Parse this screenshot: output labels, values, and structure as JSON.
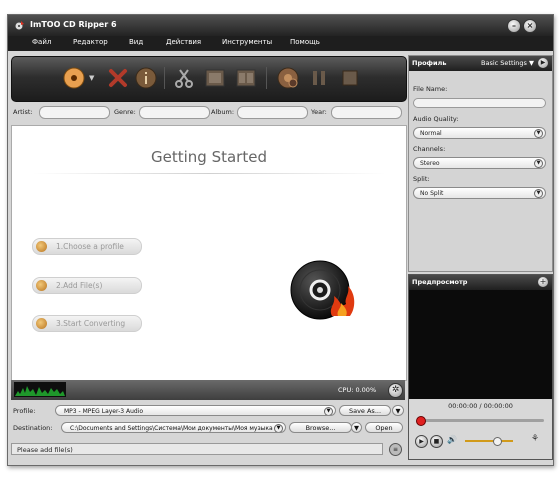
{
  "window": {
    "title": "ImTOO CD Ripper 6"
  },
  "menu": [
    "Файл",
    "Редактор",
    "Вид",
    "Действия",
    "Инструменты",
    "Помощь"
  ],
  "metadata": {
    "artist_label": "Artist:",
    "genre_label": "Genre:",
    "album_label": "Album:",
    "year_label": "Year:"
  },
  "content": {
    "title": "Getting Started",
    "steps": [
      "1.Choose a profile",
      "2.Add File(s)",
      "3.Start Converting"
    ]
  },
  "status_row": {
    "cpu": "CPU: 0.00%"
  },
  "profile_row": {
    "label": "Profile:",
    "value": "MP3 - MPEG Layer-3 Audio",
    "save_as": "Save As..."
  },
  "destination_row": {
    "label": "Destination:",
    "value": "C:\\Documents and Settings\\Система\\Мои документы\\Моя музыка",
    "browse": "Browse...",
    "open": "Open"
  },
  "statusbar": {
    "message": "Please add file(s)"
  },
  "profile_panel": {
    "title": "Профиль",
    "settings_label": "Basic Settings",
    "file_name_label": "File Name:",
    "audio_quality_label": "Audio Quality:",
    "audio_quality_value": "Normal",
    "channels_label": "Channels:",
    "channels_value": "Stereo",
    "split_label": "Split:",
    "split_value": "No Split"
  },
  "preview": {
    "title": "Предпросмотр",
    "time": "00:00:00 / 00:00:00"
  },
  "colors": {
    "titlebar": "#2b2b2b",
    "accent_red": "#e02020",
    "volume": "#d19a1a"
  }
}
